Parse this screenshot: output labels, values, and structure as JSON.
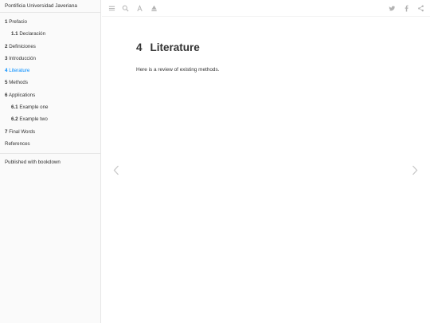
{
  "sidebar": {
    "title": "Pontificia Universidad Javeriana",
    "toc": [
      {
        "num": "1",
        "label": "Prefacio",
        "sub": false,
        "active": false
      },
      {
        "num": "1.1",
        "label": "Declaración",
        "sub": true,
        "active": false
      },
      {
        "num": "2",
        "label": "Definiciones",
        "sub": false,
        "active": false
      },
      {
        "num": "3",
        "label": "Introducción",
        "sub": false,
        "active": false
      },
      {
        "num": "4",
        "label": "Literature",
        "sub": false,
        "active": true
      },
      {
        "num": "5",
        "label": "Methods",
        "sub": false,
        "active": false
      },
      {
        "num": "6",
        "label": "Applications",
        "sub": false,
        "active": false
      },
      {
        "num": "6.1",
        "label": "Example one",
        "sub": true,
        "active": false
      },
      {
        "num": "6.2",
        "label": "Example two",
        "sub": true,
        "active": false
      },
      {
        "num": "7",
        "label": "Final Words",
        "sub": false,
        "active": false
      },
      {
        "num": "",
        "label": "References",
        "sub": false,
        "active": false
      }
    ],
    "footer": "Published with bookdown"
  },
  "toolbar": {
    "left_icons": [
      "menu-icon",
      "search-icon",
      "font-icon",
      "edit-icon"
    ],
    "right_icons": [
      "twitter-icon",
      "facebook-icon",
      "share-icon"
    ]
  },
  "main": {
    "chapter_number": "4",
    "chapter_title": "Literature",
    "text": "Here is a review of existing methods."
  },
  "colors": {
    "accent": "#008cff",
    "sidebar_bg": "#fafafa",
    "text": "#333333",
    "icon": "#b3b3b3"
  }
}
